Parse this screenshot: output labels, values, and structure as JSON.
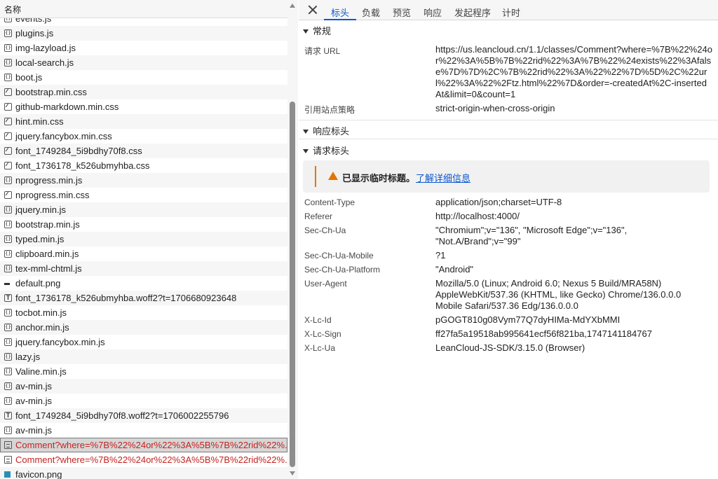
{
  "network": {
    "name_column": "名称",
    "files": [
      {
        "name": "events.js",
        "icon": "js"
      },
      {
        "name": "plugins.js",
        "icon": "js"
      },
      {
        "name": "img-lazyload.js",
        "icon": "js"
      },
      {
        "name": "local-search.js",
        "icon": "js"
      },
      {
        "name": "boot.js",
        "icon": "js"
      },
      {
        "name": "bootstrap.min.css",
        "icon": "css"
      },
      {
        "name": "github-markdown.min.css",
        "icon": "css"
      },
      {
        "name": "hint.min.css",
        "icon": "css"
      },
      {
        "name": "jquery.fancybox.min.css",
        "icon": "css"
      },
      {
        "name": "font_1749284_5i9bdhy70f8.css",
        "icon": "css"
      },
      {
        "name": "font_1736178_k526ubmyhba.css",
        "icon": "css"
      },
      {
        "name": "nprogress.min.js",
        "icon": "js"
      },
      {
        "name": "nprogress.min.css",
        "icon": "css"
      },
      {
        "name": "jquery.min.js",
        "icon": "js"
      },
      {
        "name": "bootstrap.min.js",
        "icon": "js"
      },
      {
        "name": "typed.min.js",
        "icon": "js"
      },
      {
        "name": "clipboard.min.js",
        "icon": "js"
      },
      {
        "name": "tex-mml-chtml.js",
        "icon": "js"
      },
      {
        "name": "default.png",
        "icon": "img"
      },
      {
        "name": "font_1736178_k526ubmyhba.woff2?t=1706680923648",
        "icon": "font"
      },
      {
        "name": "tocbot.min.js",
        "icon": "js"
      },
      {
        "name": "anchor.min.js",
        "icon": "js"
      },
      {
        "name": "jquery.fancybox.min.js",
        "icon": "js"
      },
      {
        "name": "lazy.js",
        "icon": "js"
      },
      {
        "name": "Valine.min.js",
        "icon": "js"
      },
      {
        "name": "av-min.js",
        "icon": "js"
      },
      {
        "name": "av-min.js",
        "icon": "js"
      },
      {
        "name": "font_1749284_5i9bdhy70f8.woff2?t=1706002255796",
        "icon": "font"
      },
      {
        "name": "av-min.js",
        "icon": "js"
      },
      {
        "name": "Comment?where=%7B%22%24or%22%3A%5B%7B%22rid%22%...",
        "icon": "doc",
        "error": true,
        "selected": true
      },
      {
        "name": "Comment?where=%7B%22%24or%22%3A%5B%7B%22rid%22%...",
        "icon": "doc",
        "error": true
      },
      {
        "name": "favicon.png",
        "icon": "fav"
      }
    ]
  },
  "details": {
    "tabs": [
      "标头",
      "负载",
      "预览",
      "响应",
      "发起程序",
      "计时"
    ],
    "general": {
      "title": "常规",
      "request_url_label": "请求 URL",
      "request_url_value": "https://us.leancloud.cn/1.1/classes/Comment?where=%7B%22%24or%22%3A%5B%7B%22rid%22%3A%7B%22%24exists%22%3Afalse%7D%7D%2C%7B%22rid%22%3A%22%22%7D%5D%2C%22url%22%3A%22%2Ftz.html%22%7D&order=-createdAt%2C-insertedAt&limit=0&count=1",
      "referrer_policy_label": "引用站点策略",
      "referrer_policy_value": "strict-origin-when-cross-origin"
    },
    "response_headers_title": "响应标头",
    "request_headers_title": "请求标头",
    "warning_text": "已显示临时标题。",
    "warning_link": "了解详细信息",
    "headers": [
      {
        "name": "Content-Type",
        "value": "application/json;charset=UTF-8"
      },
      {
        "name": "Referer",
        "value": "http://localhost:4000/"
      },
      {
        "name": "Sec-Ch-Ua",
        "value": "\"Chromium\";v=\"136\", \"Microsoft Edge\";v=\"136\", \"Not.A/Brand\";v=\"99\""
      },
      {
        "name": "Sec-Ch-Ua-Mobile",
        "value": "?1"
      },
      {
        "name": "Sec-Ch-Ua-Platform",
        "value": "\"Android\""
      },
      {
        "name": "User-Agent",
        "value": "Mozilla/5.0 (Linux; Android 6.0; Nexus 5 Build/MRA58N) AppleWebKit/537.36 (KHTML, like Gecko) Chrome/136.0.0.0 Mobile Safari/537.36 Edg/136.0.0.0"
      },
      {
        "name": "X-Lc-Id",
        "value": "pGOGT810g08Vym77Q7dyHIMa-MdYXbMMI"
      },
      {
        "name": "X-Lc-Sign",
        "value": "ff27fa5a19518ab995641ecf56f821ba,1747141184767"
      },
      {
        "name": "X-Lc-Ua",
        "value": "LeanCloud-JS-SDK/3.15.0 (Browser)"
      }
    ]
  },
  "colors": {
    "accent": "#0b57d0",
    "error_text": "#c5221f",
    "warning": "#e37400"
  }
}
